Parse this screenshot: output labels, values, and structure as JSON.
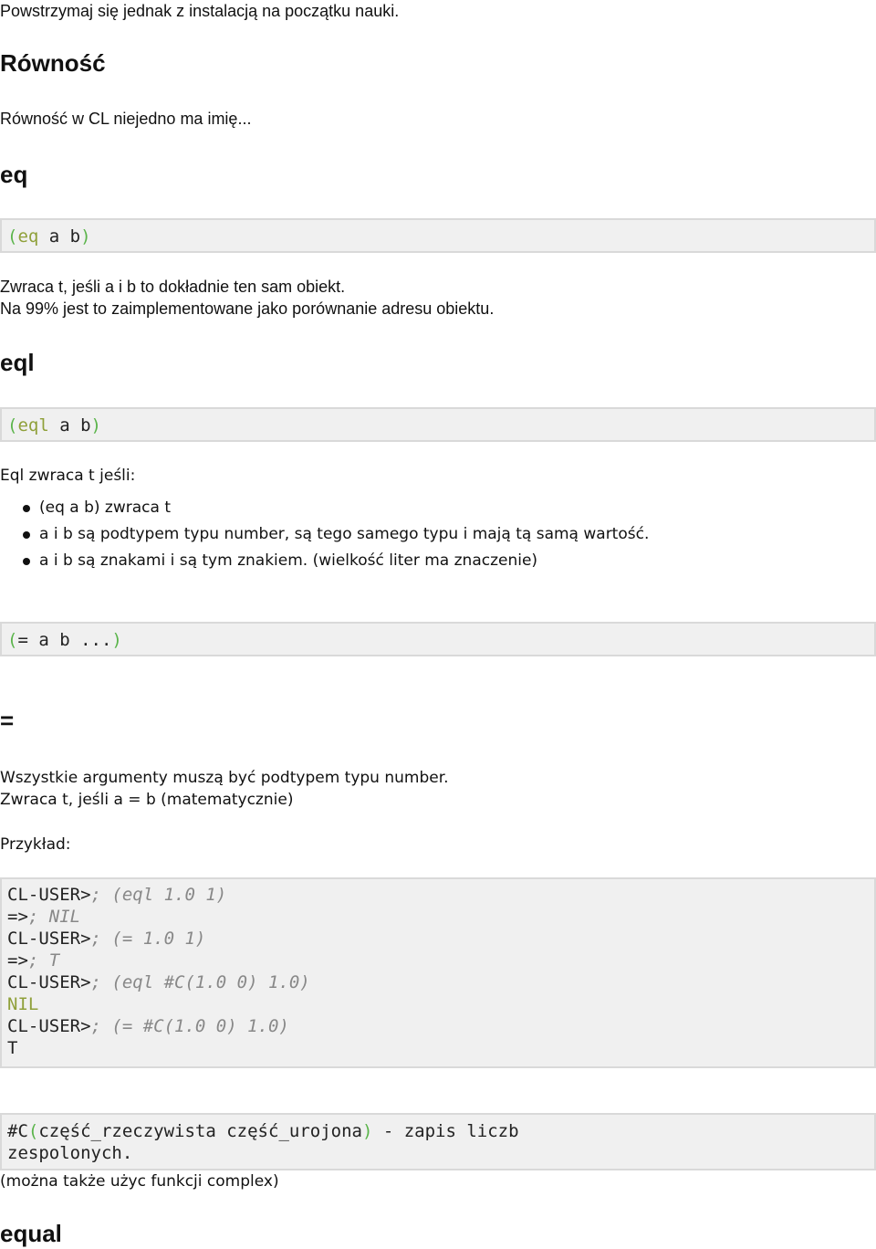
{
  "intro": "Powstrzymaj się jednak z instalacją na początku nauki.",
  "section_title": "Równość",
  "section_intro": "Równość w CL niejedno ma imię...",
  "eq": {
    "title": "eq",
    "code_open": "(",
    "code_fn": "eq",
    "code_args": " a b",
    "code_close": ")",
    "desc1": "Zwraca t, jeśli a i b to dokładnie ten sam obiekt.",
    "desc2": "Na 99% jest to zaimplementowane jako porównanie adresu obiektu."
  },
  "eql": {
    "title": "eql",
    "code_open": "(",
    "code_fn": "eql",
    "code_args": " a b",
    "code_close": ")",
    "desc": "Eql zwraca t jeśli:",
    "bullets": [
      "(eq a b) zwraca t",
      "a i b są podtypem typu number, są tego samego typu i mają tą samą wartość.",
      "a i b są znakami i są tym znakiem. (wielkość liter ma znaczenie)"
    ]
  },
  "equals_code": {
    "open": "(",
    "body": "= a b ...",
    "close": ")"
  },
  "equals": {
    "title": "=",
    "desc1": "Wszystkie argumenty muszą być podtypem typu number.",
    "desc2": "Zwraca t, jeśli a = b (matematycznie)",
    "example_label": "Przykład:"
  },
  "example": {
    "l1_prompt": "CL-USER>",
    "l1_code": "; (eql 1.0 1)",
    "l2_prompt": "=>",
    "l2_code": "; NIL",
    "l3_prompt": "CL-USER>",
    "l3_code": "; (= 1.0 1)",
    "l4_prompt": "=>",
    "l4_code": "; T",
    "l5_prompt": "CL-USER>",
    "l5_code": "; (eql #C(1.0 0) 1.0)",
    "l6": "NIL",
    "l7_prompt": "CL-USER>",
    "l7_code": "; (= #C(1.0 0) 1.0)",
    "l8": "T"
  },
  "complex": {
    "prefix": "#C",
    "open": "(",
    "args": "część_rzeczywista część_urojona",
    "close": ")",
    "rest1": " - zapis liczb",
    "line2": "zespolonych.",
    "note": "(można także użyc funkcji complex)"
  },
  "equal": {
    "title": "equal"
  }
}
